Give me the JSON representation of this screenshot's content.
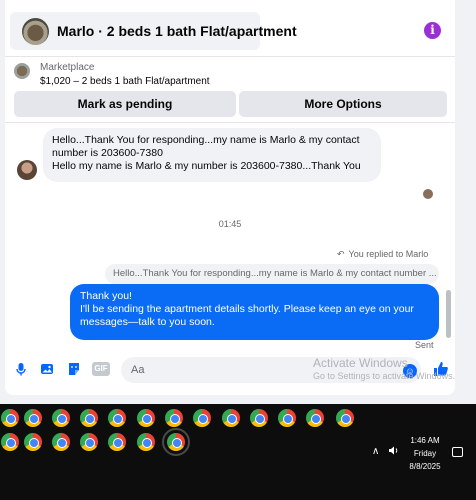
{
  "header": {
    "title": "Marlo · 2 beds 1 bath Flat/apartment",
    "info_icon": "info-icon",
    "info_glyph": "i"
  },
  "listing": {
    "source": "Marketplace",
    "price_line": "$1,020 – 2 beds 1 bath Flat/apartment"
  },
  "actions": {
    "mark_pending": "Mark as pending",
    "more_options": "More Options"
  },
  "messages": {
    "incoming_line1": "Hello...Thank You for responding...my name is Marlo & my contact number is 203600-7380",
    "incoming_line2": "Hello my name is Marlo & my number is 203600-7380...Thank You",
    "timestamp": "01:45",
    "replied_label": "You replied to Marlo",
    "quoted_text": "Hello...Thank You for responding...my name is Marlo & my contact number ...",
    "outgoing_line1": "Thank you!",
    "outgoing_line2": "I'll be sending the apartment details shortly. Please keep an eye on your messages—talk to you soon.",
    "status": "Sent"
  },
  "composer": {
    "placeholder": "Aa",
    "gif_label": "GIF"
  },
  "watermark": {
    "line1": "Activate Windows",
    "line2": "Go to Settings to activate Windows."
  },
  "taskbar": {
    "time": "1:46 AM",
    "day": "Friday",
    "date": "8/8/2025"
  },
  "colors": {
    "accent": "#0866ff",
    "outgoing_bubble": "#0a6cf5",
    "incoming_bubble": "#f0f2f5",
    "info_icon": "#9b2fd6",
    "taskbar": "#0d0d0d"
  }
}
